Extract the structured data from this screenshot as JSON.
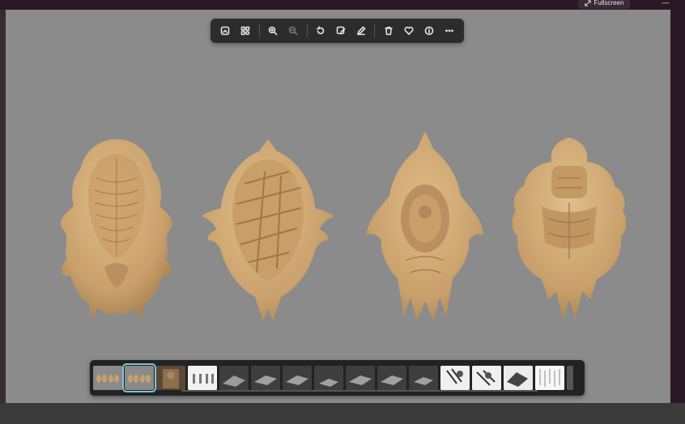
{
  "window": {
    "fullscreen_label": "Fullscreen",
    "minimize_label": "—"
  },
  "toolbar": {
    "buttons": [
      {
        "icon": "crop-image-icon",
        "enabled": true
      },
      {
        "icon": "visual-search-icon",
        "enabled": true
      },
      {
        "icon": "zoom-in-icon",
        "enabled": true
      },
      {
        "icon": "zoom-out-icon",
        "enabled": false
      },
      {
        "icon": "rotate-icon",
        "enabled": true
      },
      {
        "icon": "edit-image-icon",
        "enabled": true
      },
      {
        "icon": "draw-icon",
        "enabled": true
      },
      {
        "icon": "delete-icon",
        "enabled": true
      },
      {
        "icon": "favorite-icon",
        "enabled": true
      },
      {
        "icon": "info-icon",
        "enabled": true
      },
      {
        "icon": "more-icon",
        "enabled": true
      }
    ]
  },
  "image": {
    "background_color": "#8b8b8b",
    "model_color": "#d2ad7a",
    "models": [
      "armor-plate-1",
      "armor-plate-2",
      "armor-plate-3",
      "armor-plate-4"
    ]
  },
  "filmstrip": {
    "selected_index": 1,
    "thumbnails": [
      {
        "kind": "models-gray"
      },
      {
        "kind": "models-gray"
      },
      {
        "kind": "photo"
      },
      {
        "kind": "white-figures"
      },
      {
        "kind": "dark-render"
      },
      {
        "kind": "dark-render"
      },
      {
        "kind": "dark-render"
      },
      {
        "kind": "dark-render"
      },
      {
        "kind": "dark-render"
      },
      {
        "kind": "dark-render"
      },
      {
        "kind": "dark-render"
      },
      {
        "kind": "white-sketch"
      },
      {
        "kind": "white-sketch"
      },
      {
        "kind": "white-sketch"
      },
      {
        "kind": "white-figures"
      },
      {
        "kind": "dark-render"
      }
    ]
  }
}
